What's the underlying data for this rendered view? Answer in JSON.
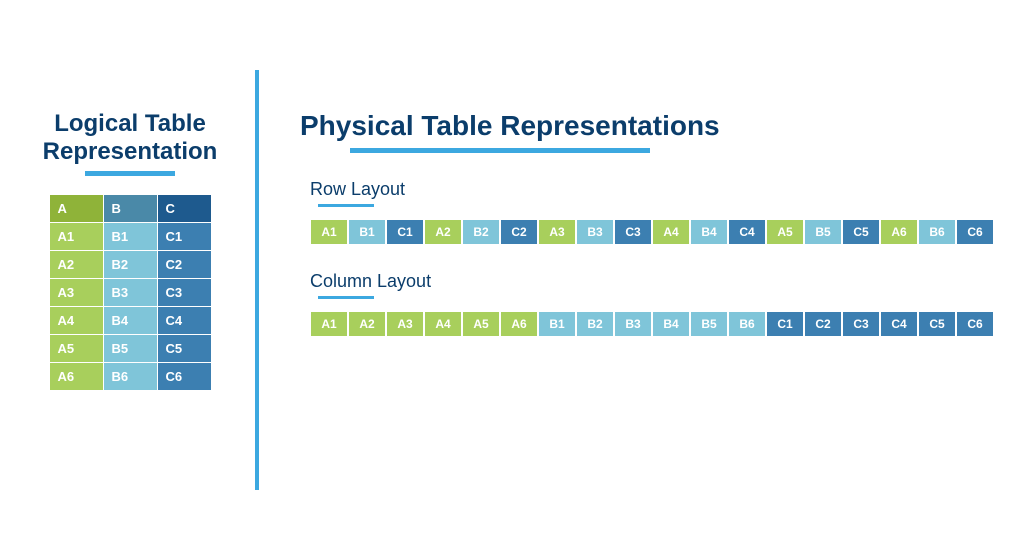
{
  "logical": {
    "title_line1": "Logical Table",
    "title_line2": "Representation",
    "headers": [
      "A",
      "B",
      "C"
    ],
    "rows": [
      [
        "A1",
        "B1",
        "C1"
      ],
      [
        "A2",
        "B2",
        "C2"
      ],
      [
        "A3",
        "B3",
        "C3"
      ],
      [
        "A4",
        "B4",
        "C4"
      ],
      [
        "A5",
        "B5",
        "C5"
      ],
      [
        "A6",
        "B6",
        "C6"
      ]
    ]
  },
  "physical": {
    "title": "Physical Table Representations",
    "row_layout": {
      "label": "Row Layout",
      "cells": [
        "A1",
        "B1",
        "C1",
        "A2",
        "B2",
        "C2",
        "A3",
        "B3",
        "C3",
        "A4",
        "B4",
        "C4",
        "A5",
        "B5",
        "C5",
        "A6",
        "B6",
        "C6"
      ]
    },
    "column_layout": {
      "label": "Column Layout",
      "cells": [
        "A1",
        "A2",
        "A3",
        "A4",
        "A5",
        "A6",
        "B1",
        "B2",
        "B3",
        "B4",
        "B5",
        "B6",
        "C1",
        "C2",
        "C3",
        "C4",
        "C5",
        "C6"
      ]
    }
  },
  "colors": {
    "A_header": "#8FB339",
    "A_cell": "#A8CF5C",
    "B_header": "#4A89A8",
    "B_cell": "#7FC5D9",
    "C_header": "#1E5A8E",
    "C_cell": "#3C7FB1",
    "accent": "#3CA8E0",
    "title": "#0B3D6B"
  }
}
